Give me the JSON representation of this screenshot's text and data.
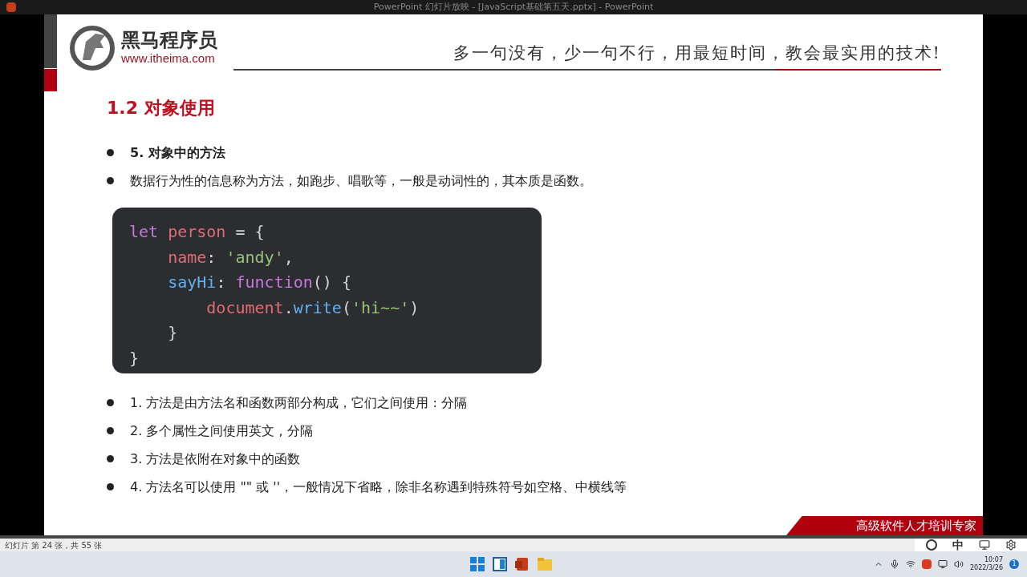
{
  "window": {
    "title": "PowerPoint 幻灯片放映 - [JavaScript基础第五天.pptx] - PowerPoint"
  },
  "slide": {
    "logo": {
      "name": "黑马程序员",
      "url": "www.itheima.com"
    },
    "slogan": "多一句没有，少一句不行，用最短时间，教会最实用的技术!",
    "heading": "1.2 对象使用",
    "intro": [
      {
        "text": "5. 对象中的方法",
        "bold": true
      },
      {
        "text": "数据行为性的信息称为方法，如跑步、唱歌等，一般是动词性的，其本质是函数。",
        "bold": false
      }
    ],
    "code_lines": [
      {
        "tokens": [
          {
            "text": "let",
            "color": "#c678dd"
          },
          {
            "text": " person",
            "color": "#e06c75"
          },
          {
            "text": " = {",
            "color": "#d4d4d4"
          }
        ]
      },
      {
        "tokens": [
          {
            "text": "    name",
            "color": "#e06c75"
          },
          {
            "text": ": ",
            "color": "#d4d4d4"
          },
          {
            "text": "'andy'",
            "color": "#98c379"
          },
          {
            "text": ",",
            "color": "#d4d4d4"
          }
        ]
      },
      {
        "tokens": [
          {
            "text": "    sayHi",
            "color": "#61afef"
          },
          {
            "text": ": ",
            "color": "#d4d4d4"
          },
          {
            "text": "function",
            "color": "#c678dd"
          },
          {
            "text": "() {",
            "color": "#d4d4d4"
          }
        ]
      },
      {
        "tokens": [
          {
            "text": "        document",
            "color": "#e06c75"
          },
          {
            "text": ".",
            "color": "#d4d4d4"
          },
          {
            "text": "write",
            "color": "#61afef"
          },
          {
            "text": "(",
            "color": "#d4d4d4"
          },
          {
            "text": "'hi~~'",
            "color": "#98c379"
          },
          {
            "text": ")",
            "color": "#d4d4d4"
          }
        ]
      },
      {
        "tokens": [
          {
            "text": "    }",
            "color": "#d4d4d4"
          }
        ]
      },
      {
        "tokens": [
          {
            "text": "}",
            "color": "#d4d4d4"
          }
        ]
      }
    ],
    "notes": [
      {
        "text": "1. 方法是由方法名和函数两部分构成，它们之间使用 : 分隔",
        "bold": false
      },
      {
        "text": "2. 多个属性之间使用英文 , 分隔",
        "bold": false
      },
      {
        "text": "3. 方法是依附在对象中的函数",
        "bold": false
      },
      {
        "text": "4. 方法名可以使用 \"\" 或 ''，一般情况下省略，除非名称遇到特殊符号如空格、中横线等",
        "bold": false
      }
    ],
    "banner": "高级软件人才培训专家"
  },
  "status_bar": "幻灯片 第 24 张，共 55 张",
  "ime_toolbar": {
    "mode": "中"
  },
  "taskbar": {
    "time": "10:07",
    "date": "2022/3/26",
    "notifications": "1"
  }
}
